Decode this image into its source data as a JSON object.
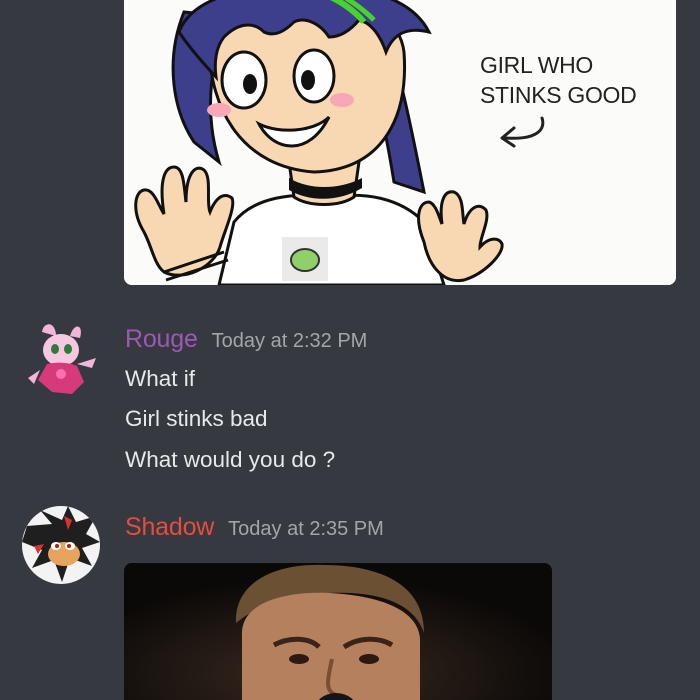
{
  "messages": [
    {
      "author": "",
      "attachment": {
        "type": "image",
        "caption": "GIRL WHO\nSTINKS GOOD",
        "arrow_icon": "curved-arrow-icon"
      }
    },
    {
      "author": "Rouge",
      "author_color": "#9b59b6",
      "timestamp": "Today at 2:32 PM",
      "lines": [
        "What if",
        "Girl stinks bad",
        "What would you do ?"
      ]
    },
    {
      "author": "Shadow",
      "author_color": "#e74c3c",
      "timestamp": "Today at 2:35 PM",
      "attachment": {
        "type": "image"
      }
    }
  ],
  "colors": {
    "background": "#36393f",
    "message_text": "#dcddde",
    "timestamp": "#a3a6aa"
  }
}
